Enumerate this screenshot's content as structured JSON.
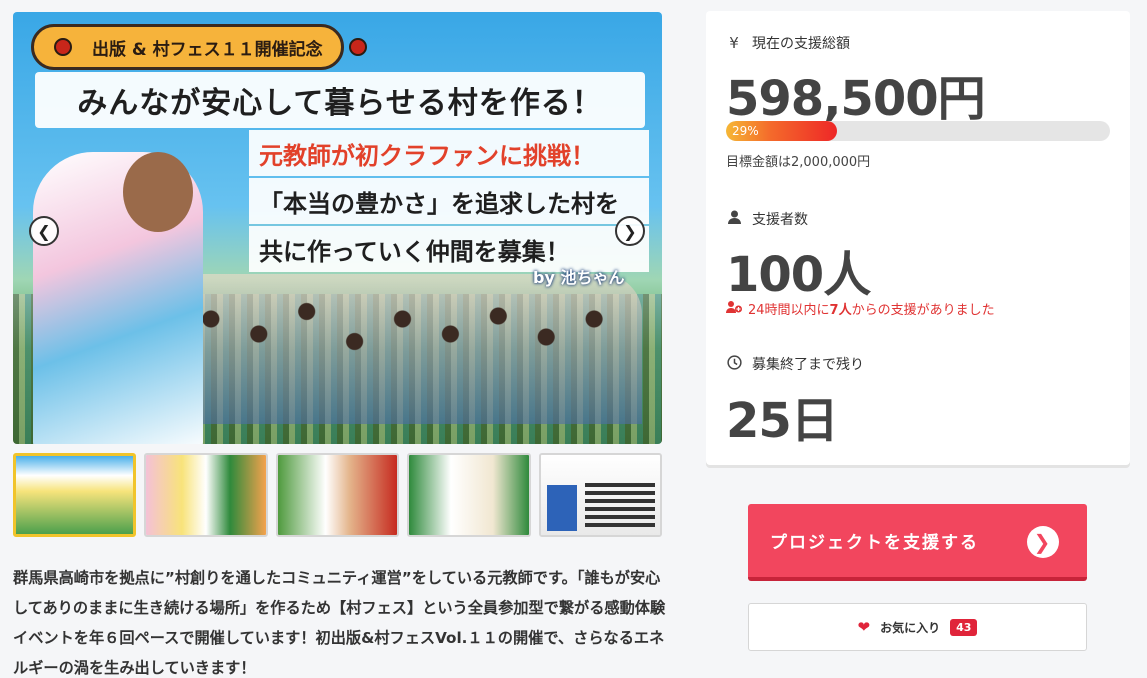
{
  "hero": {
    "badge": "出版 & 村フェス１１開催記念",
    "headline": "みんなが安心して暮らせる村を作る！",
    "catch_lines": [
      "元教師が初クラファンに挑戦！",
      "「本当の豊かさ」を追求した村を",
      "共に作っていく仲間を募集！"
    ],
    "byline": "by 池ちゃん",
    "prev_icon": "chevron-left-icon",
    "next_icon": "chevron-right-icon"
  },
  "thumbnails": [
    {
      "label": "thumbnail-1",
      "active": true
    },
    {
      "label": "thumbnail-2",
      "active": false
    },
    {
      "label": "thumbnail-3",
      "active": false
    },
    {
      "label": "thumbnail-4",
      "active": false
    },
    {
      "label": "thumbnail-5",
      "active": false
    }
  ],
  "description": "群馬県高崎市を拠点に”村創りを通したコミュニティ運営”をしている元教師です。「誰もが安心してありのままに生き続ける場所」を作るため【村フェス】という全員参加型で繋がる感動体験イベントを年６回ペースで開催しています！初出版&村フェスVol.１１の開催で、さらなるエネルギーの渦を生み出していきます！",
  "stats": {
    "funding": {
      "icon": "yen-icon",
      "label": "現在の支援総額",
      "amount": "598,500円",
      "progress_percent": 29,
      "progress_label": "29%",
      "goal_text": "目標金額は2,000,000円"
    },
    "backers": {
      "icon": "user-icon",
      "label": "支援者数",
      "count": "100人",
      "recent_prefix": "24時間以内に",
      "recent_count": "7人",
      "recent_suffix": "からの支援がありました"
    },
    "remaining": {
      "icon": "clock-icon",
      "label": "募集終了まで残り",
      "value": "25日"
    }
  },
  "actions": {
    "support_label": "プロジェクトを支援する",
    "favorite_label": "お気に入り",
    "favorite_count": "43"
  },
  "colors": {
    "accent": "#f2465e",
    "alert": "#e03333",
    "progress_start": "#f6b735",
    "progress_end": "#ee2727"
  }
}
